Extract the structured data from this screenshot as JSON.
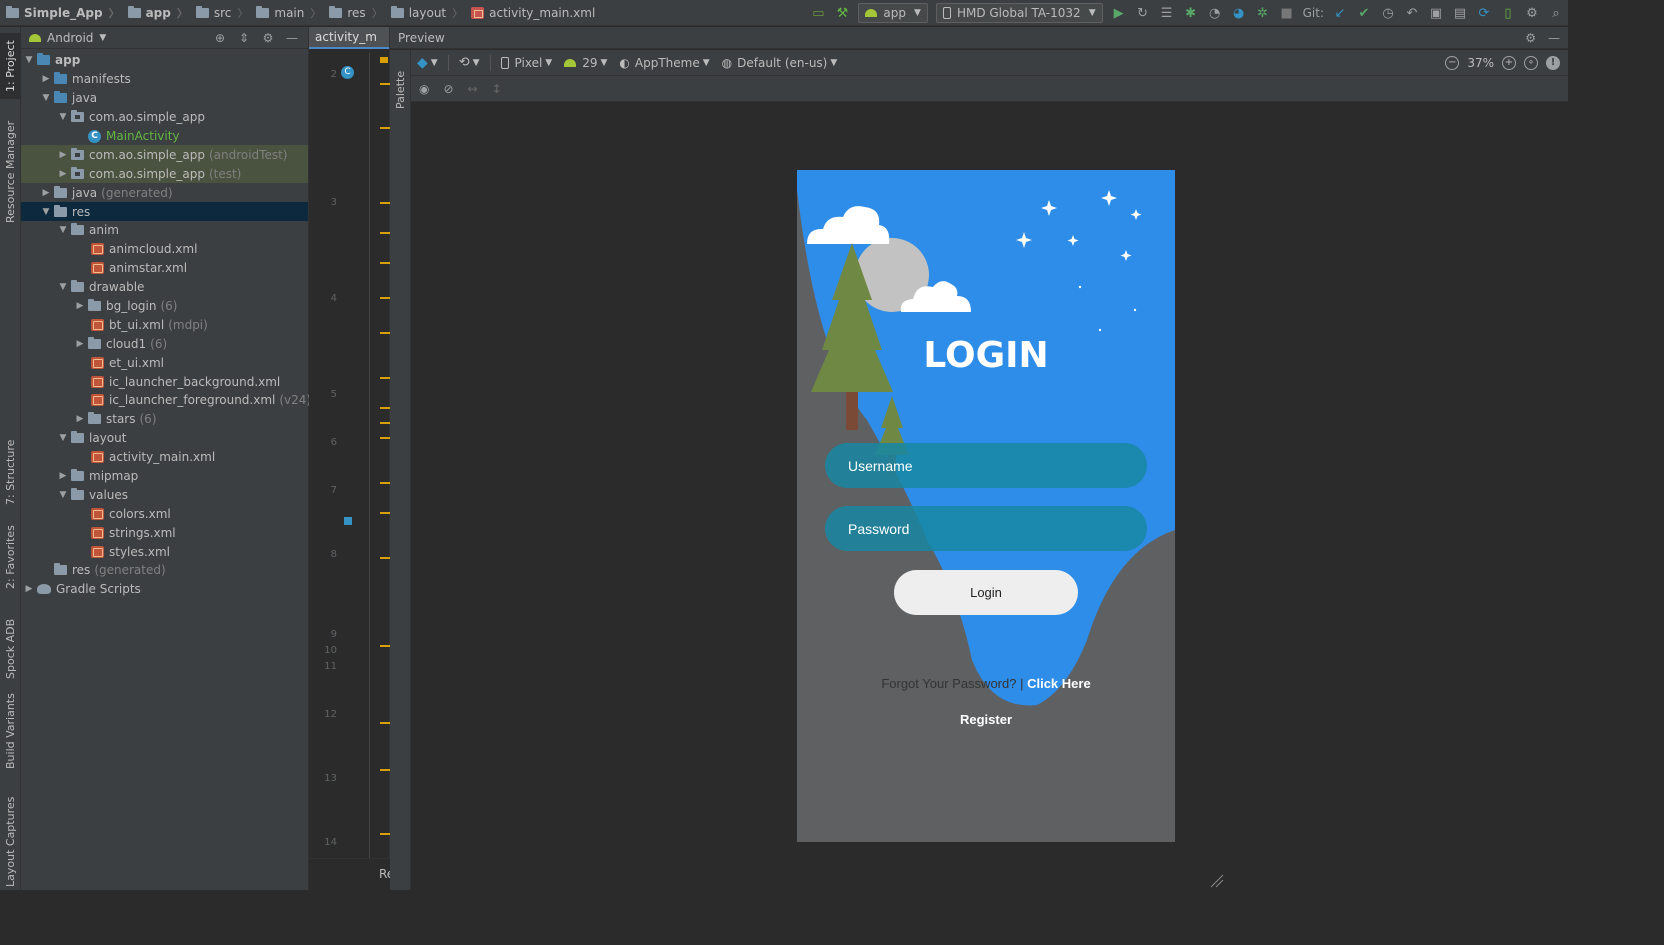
{
  "navbar": {
    "crumbs": [
      "Simple_App",
      "app",
      "src",
      "main",
      "res",
      "layout",
      "activity_main.xml"
    ],
    "run_config": "app",
    "device": "HMD Global TA-1032",
    "git_label": "Git:"
  },
  "side_tabs": {
    "project": "1: Project",
    "resource_manager": "Resource Manager",
    "structure": "7: Structure",
    "favorites": "2: Favorites",
    "spock_adb": "Spock ADB",
    "build_variants": "Build Variants",
    "layout_captures": "Layout Captures"
  },
  "project_panel": {
    "view_mode": "Android",
    "tree": [
      {
        "label": "app",
        "suffix": ""
      },
      {
        "label": "manifests",
        "suffix": ""
      },
      {
        "label": "java",
        "suffix": ""
      },
      {
        "label": "com.ao.simple_app",
        "suffix": ""
      },
      {
        "label": "MainActivity",
        "suffix": ""
      },
      {
        "label": "com.ao.simple_app",
        "suffix": "(androidTest)"
      },
      {
        "label": "com.ao.simple_app",
        "suffix": "(test)"
      },
      {
        "label": "java",
        "suffix": "(generated)"
      },
      {
        "label": "res",
        "suffix": ""
      },
      {
        "label": "anim",
        "suffix": ""
      },
      {
        "label": "animcloud.xml",
        "suffix": ""
      },
      {
        "label": "animstar.xml",
        "suffix": ""
      },
      {
        "label": "drawable",
        "suffix": ""
      },
      {
        "label": "bg_login",
        "suffix": "(6)"
      },
      {
        "label": "bt_ui.xml",
        "suffix": "(mdpi)"
      },
      {
        "label": "cloud1",
        "suffix": "(6)"
      },
      {
        "label": "et_ui.xml",
        "suffix": ""
      },
      {
        "label": "ic_launcher_background.xml",
        "suffix": ""
      },
      {
        "label": "ic_launcher_foreground.xml",
        "suffix": "(v24)"
      },
      {
        "label": "stars",
        "suffix": "(6)"
      },
      {
        "label": "layout",
        "suffix": ""
      },
      {
        "label": "activity_main.xml",
        "suffix": ""
      },
      {
        "label": "mipmap",
        "suffix": ""
      },
      {
        "label": "values",
        "suffix": ""
      },
      {
        "label": "colors.xml",
        "suffix": ""
      },
      {
        "label": "strings.xml",
        "suffix": ""
      },
      {
        "label": "styles.xml",
        "suffix": ""
      },
      {
        "label": "res",
        "suffix": "(generated)"
      },
      {
        "label": "Gradle Scripts",
        "suffix": ""
      }
    ]
  },
  "editor": {
    "tab_label": "activity_m",
    "line_numbers": [
      "2",
      "3",
      "4",
      "5",
      "6",
      "7",
      "8",
      "9",
      "10",
      "11",
      "12",
      "13",
      "14"
    ],
    "bottom_text": "Re"
  },
  "preview": {
    "title": "Preview",
    "palette_label": "Palette",
    "device": "Pixel",
    "api": "29",
    "theme": "AppTheme",
    "locale": "Default (en-us)",
    "zoom": "37%"
  },
  "login_screen": {
    "title": "LOGIN",
    "username_hint": "Username",
    "password_hint": "Password",
    "login_button": "Login",
    "forgot_text": "Forgot Your Password? |",
    "click_here": "Click Here",
    "register": "Register"
  },
  "colors": {
    "sky": "#2e8de8",
    "hill": "#5f6062",
    "tree": "#6f8944",
    "field": "#1887a3",
    "ide_bg": "#2b2b2b",
    "panel_bg": "#3c3f41",
    "selection": "#0d293e"
  }
}
